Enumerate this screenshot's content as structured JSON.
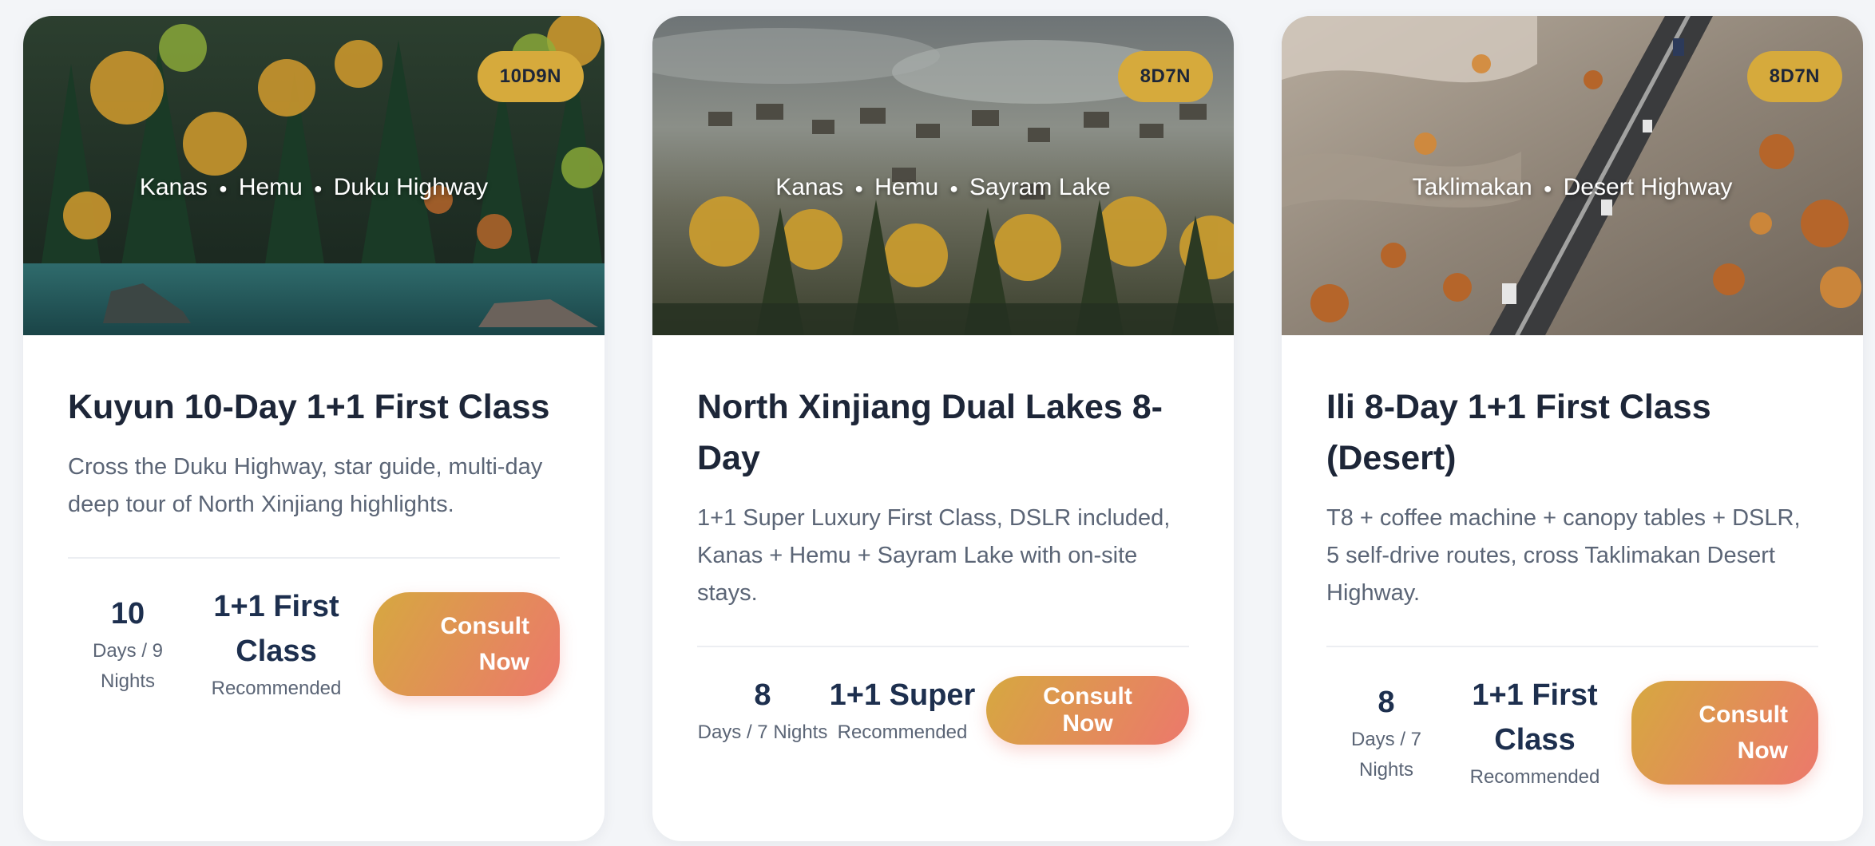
{
  "cards": [
    {
      "badge": "10D9N",
      "route": [
        "Kanas",
        "Hemu",
        "Duku Highway"
      ],
      "title": "Kuyun 10-Day 1+1 First Class",
      "description": "Cross the Duku Highway, star guide, multi-day deep tour of North Xinjiang highlights.",
      "duration_value": "10",
      "duration_label": "Days / 9 Nights",
      "class_value": "1+1 First Class",
      "class_label": "Recommended",
      "button_label": "Consult Now"
    },
    {
      "badge": "8D7N",
      "route": [
        "Kanas",
        "Hemu",
        "Sayram Lake"
      ],
      "title": "North Xinjiang Dual Lakes 8-Day",
      "description": "1+1 Super Luxury First Class, DSLR included, Kanas + Hemu + Sayram Lake with on-site stays.",
      "duration_value": "8",
      "duration_label": "Days / 7 Nights",
      "class_value": "1+1 Super",
      "class_label": "Recommended",
      "button_label": "Consult Now"
    },
    {
      "badge": "8D7N",
      "route": [
        "Taklimakan",
        "Desert Highway"
      ],
      "title": "Ili 8-Day 1+1 First Class (Desert)",
      "description": "T8 + coffee machine + canopy tables + DSLR, 5 self-drive routes, cross Taklimakan Desert Highway.",
      "duration_value": "8",
      "duration_label": "Days / 7 Nights",
      "class_value": "1+1 First Class",
      "class_label": "Recommended",
      "button_label": "Consult Now"
    }
  ],
  "colors": {
    "badge": "#d6aa3c",
    "button_start": "#d6a840",
    "button_end": "#ec786c",
    "title": "#1d2638",
    "muted": "#5b6576"
  }
}
